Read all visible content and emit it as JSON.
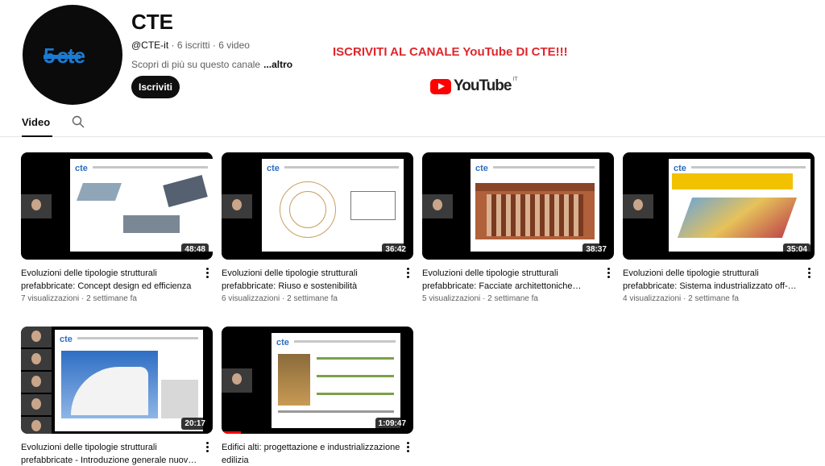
{
  "channel": {
    "name": "CTE",
    "handle": "@CTE-it",
    "subscribers": "6 iscritti",
    "videos_count": "6 video",
    "separator": "·",
    "about": "Scopri di più su questo canale",
    "more": "...altro",
    "subscribe_label": "Iscriviti",
    "avatar_text": "5"
  },
  "promo": {
    "text": "ISCRIVITI AL CANALE YouTube DI CTE!!!",
    "youtube_word": "YouTube",
    "youtube_sup": "IT"
  },
  "tabs": {
    "video": "Video"
  },
  "videos": [
    {
      "title": "Evoluzioni delle tipologie strutturali prefabbricate: Concept design ed efficienza",
      "duration": "48:48",
      "views": "7 visualizzazioni",
      "age": "2 settimane fa"
    },
    {
      "title": "Evoluzioni delle tipologie strutturali prefabbricate: Riuso e sostenibilità",
      "duration": "36:42",
      "views": "6 visualizzazioni",
      "age": "2 settimane fa"
    },
    {
      "title": "Evoluzioni delle tipologie strutturali prefabbricate: Facciate architettoniche…",
      "duration": "38:37",
      "views": "5 visualizzazioni",
      "age": "2 settimane fa"
    },
    {
      "title": "Evoluzioni delle tipologie strutturali prefabbricate: Sistema industrializzato off-…",
      "duration": "35:04",
      "views": "4 visualizzazioni",
      "age": "2 settimane fa"
    },
    {
      "title": "Evoluzioni delle tipologie strutturali prefabbricate - Introduzione generale nuov…",
      "duration": "20:17"
    },
    {
      "title": "Edifici alti: progettazione e industrializzazione edilizia",
      "duration": "1:09:47",
      "progress_fraction": 0.1
    }
  ],
  "colors": {
    "promo": "#e0262b",
    "brand_blue": "#1b7bd3",
    "progress": "#ff0000"
  }
}
